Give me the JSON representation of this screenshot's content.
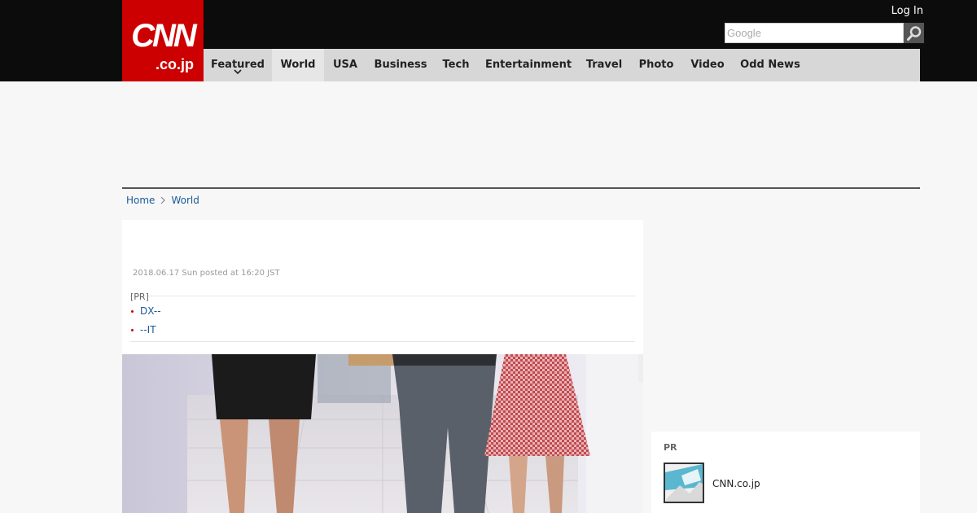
{
  "header": {
    "logo_main": "CNN",
    "logo_sub": ".co.jp",
    "login_label": "Log In",
    "search_placeholder": "Google"
  },
  "nav": {
    "items": [
      {
        "label": "Featured",
        "has_dropdown": true
      },
      {
        "label": "World",
        "active": true
      },
      {
        "label": "USA"
      },
      {
        "label": "Business"
      },
      {
        "label": "Tech"
      },
      {
        "label": "Entertainment"
      },
      {
        "label": "Travel"
      },
      {
        "label": "Photo"
      },
      {
        "label": "Video"
      },
      {
        "label": "Odd News"
      }
    ]
  },
  "breadcrumb": {
    "home": "Home",
    "current": "World"
  },
  "article": {
    "date": "2018.06.17 Sun posted at 16:20 JST",
    "pr_label": "[PR]",
    "pr_links": [
      "DX--",
      "--IT"
    ]
  },
  "sidebar": {
    "pr_label": "PR",
    "item_title": "CNN.co.jp"
  },
  "colors": {
    "brand_red": "#cc0000",
    "header_bg": "#0c0c0c",
    "nav_bg": "#d7d7d7",
    "link": "#1a5a96"
  }
}
